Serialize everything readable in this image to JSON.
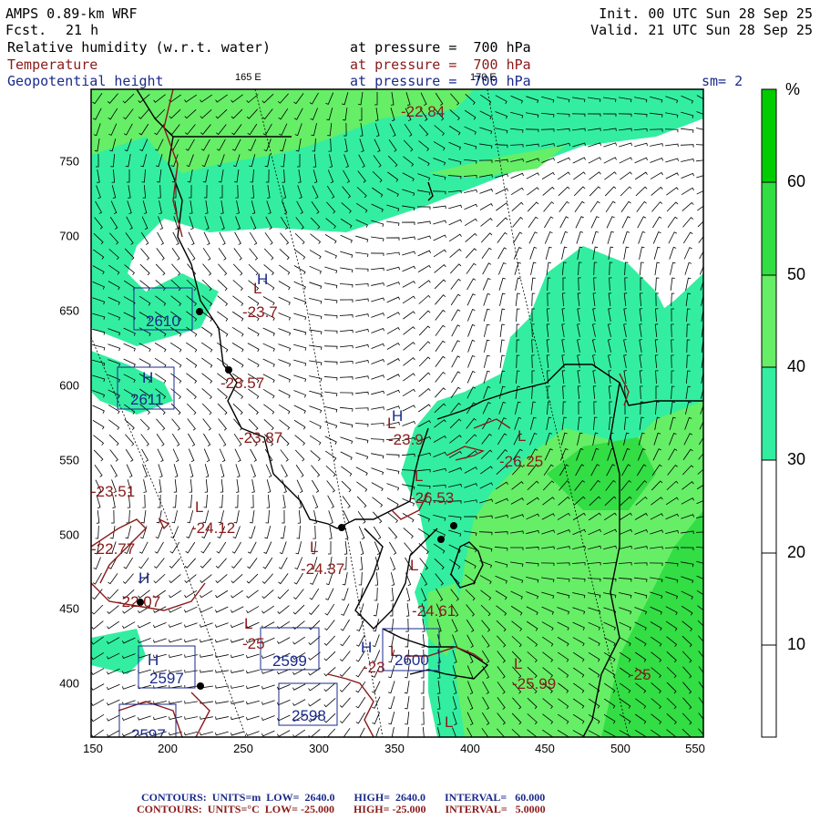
{
  "header": {
    "model": "AMPS 0.89-km WRF",
    "fcst_label": "Fcst.",
    "fcst_value": "21 h",
    "init": "Init. 00 UTC Sun 28 Sep 25",
    "valid": "Valid. 21 UTC Sun 28 Sep 25",
    "fields": [
      {
        "name": "Relative humidity (w.r.t. water)",
        "level": "at pressure =  700 hPa",
        "color": "#000000"
      },
      {
        "name": "Temperature",
        "level": "at pressure =  700 hPa",
        "color": "#8b1a1a"
      },
      {
        "name": "Geopotential height",
        "level": "at pressure =  700 hPa",
        "color": "#1a2a8b"
      }
    ],
    "smoothing": "sm= 2",
    "meridian_165": "165 E",
    "meridian_170": "170 E"
  },
  "axes": {
    "x_ticks": [
      "150",
      "200",
      "250",
      "300",
      "350",
      "400",
      "450",
      "500",
      "550"
    ],
    "y_ticks": [
      "750",
      "700",
      "650",
      "600",
      "550",
      "500",
      "450",
      "400"
    ]
  },
  "colorbar": {
    "unit": "%",
    "labels": [
      "60",
      "50",
      "40",
      "30",
      "20",
      "10"
    ],
    "colors": [
      "#00cc00",
      "#33dd44",
      "#66ee66",
      "#33eea0",
      "#ffffff",
      "#ffffff"
    ]
  },
  "contour_labels": {
    "temperature": [
      "-22.84",
      "-23.7",
      "-23.57",
      "-23.87",
      "-23.9",
      "-26.25",
      "-23.51",
      "-26.53",
      "-24.12",
      "-24.37",
      "-22.77",
      "-24.61",
      "-22.07",
      "-25",
      "-25.99",
      "-23",
      "-25"
    ],
    "highs_lows": [
      "L",
      "L",
      "L",
      "L",
      "L",
      "L",
      "L",
      "L",
      "L",
      "L",
      "L",
      "H",
      "H",
      "H",
      "H",
      "H",
      "H"
    ],
    "height": [
      "2610",
      "2611",
      "2599",
      "2597",
      "2600",
      "2598",
      "2597"
    ]
  },
  "footer": {
    "blue_line": "CONTOURS:  UNITS=m  LOW=  2640.0       HIGH=  2640.0       INTERVAL=   60.000",
    "red_line": "CONTOURS:  UNITS=°C  LOW= -25.000       HIGH= -25.000       INTERVAL=   5.0000"
  }
}
